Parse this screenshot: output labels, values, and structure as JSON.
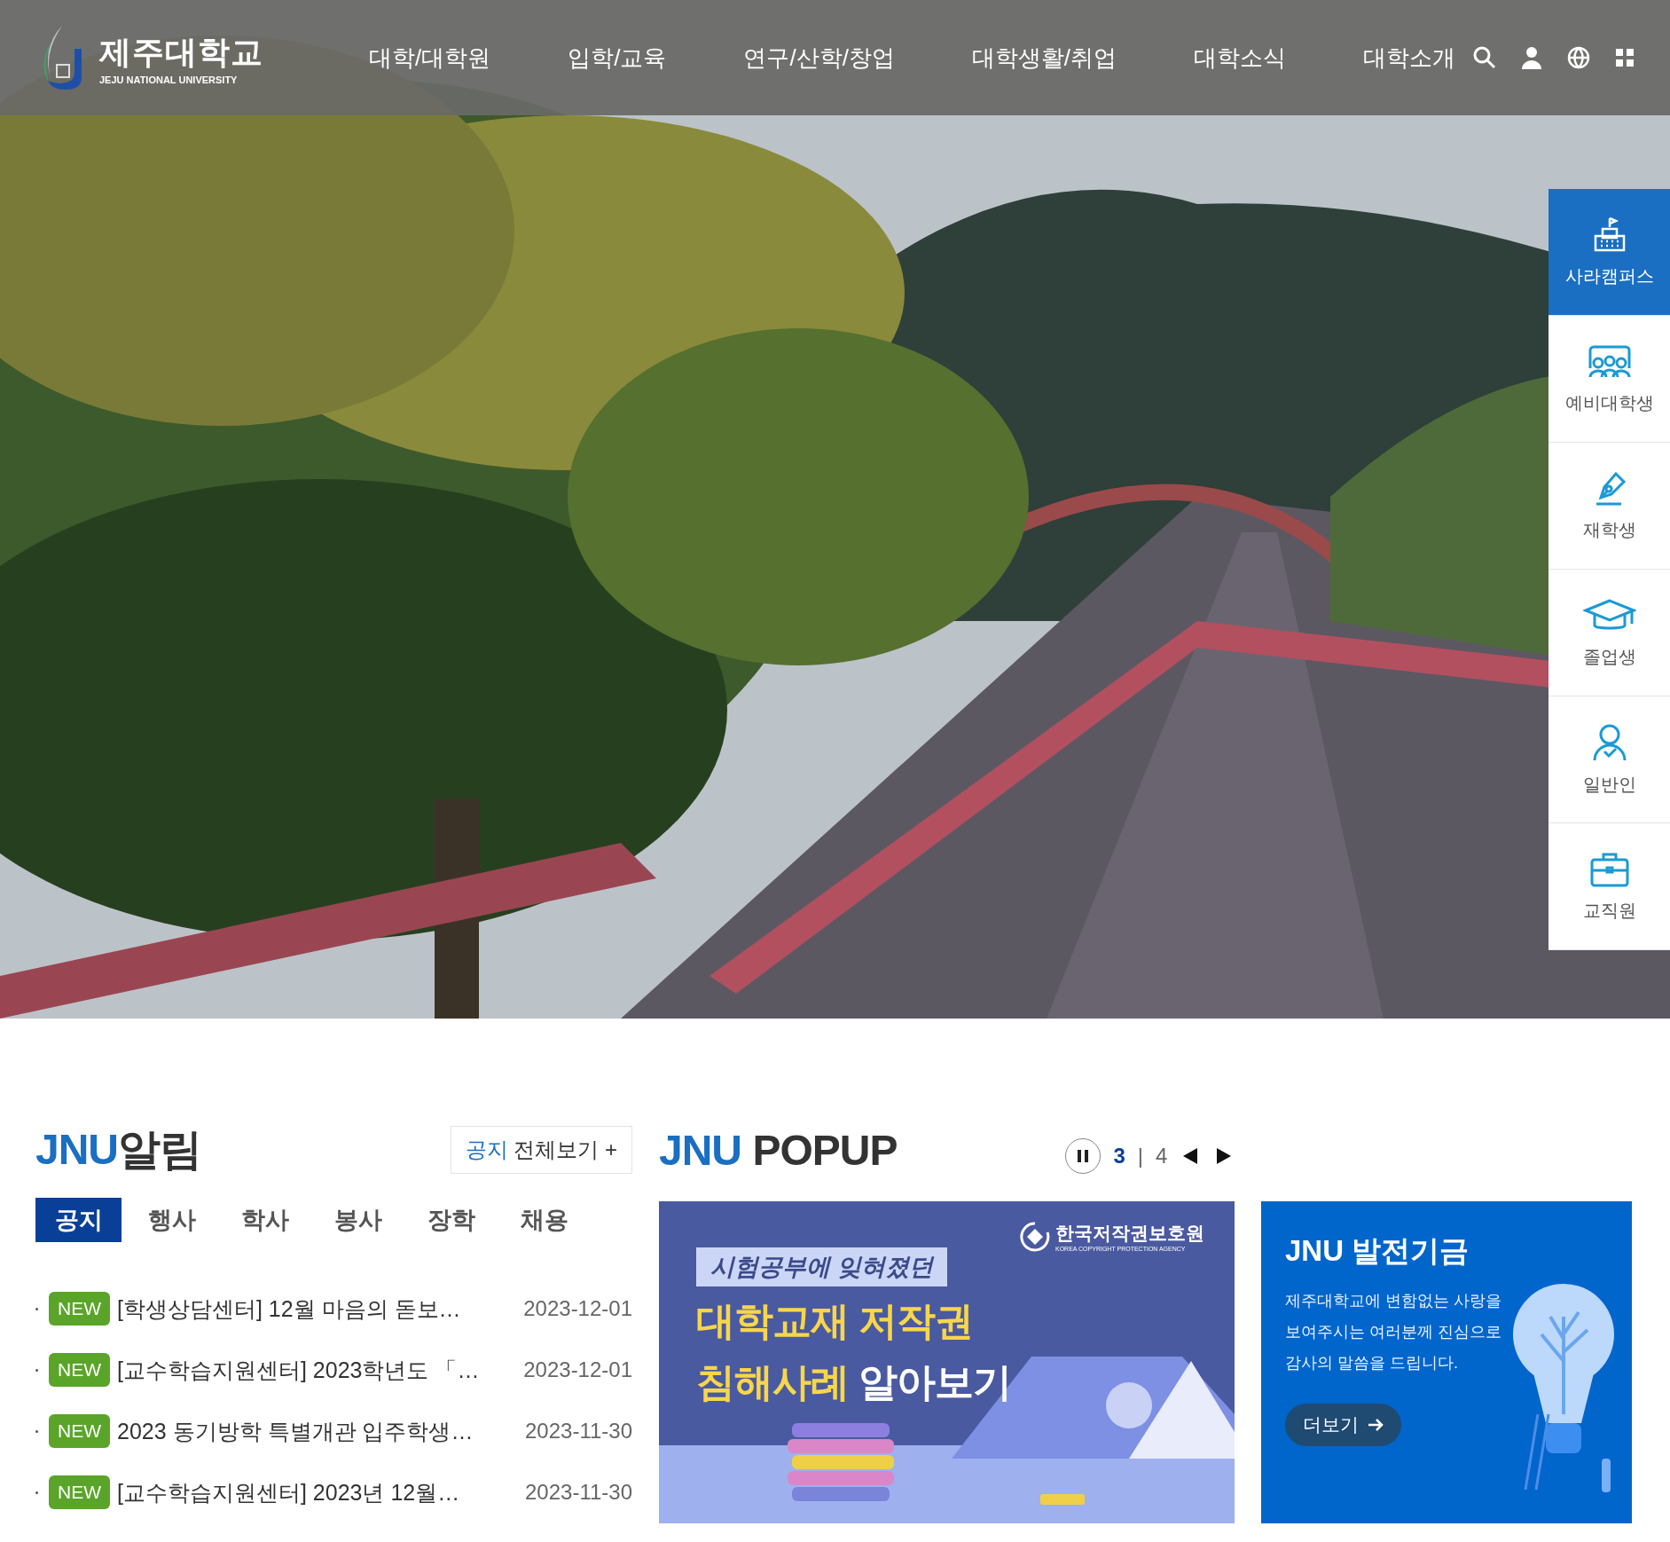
{
  "header": {
    "logo": {
      "name_ko": "제주대학교",
      "name_en": "JEJU NATIONAL UNIVERSITY"
    },
    "nav": [
      "대학/대학원",
      "입학/교육",
      "연구/산학/창업",
      "대학생활/취업",
      "대학소식",
      "대학소개"
    ]
  },
  "quick_menu": [
    {
      "label": "사라캠퍼스",
      "selected": true
    },
    {
      "label": "예비대학생",
      "selected": false
    },
    {
      "label": "재학생",
      "selected": false
    },
    {
      "label": "졸업생",
      "selected": false
    },
    {
      "label": "일반인",
      "selected": false
    },
    {
      "label": "교직원",
      "selected": false
    }
  ],
  "notices": {
    "title_prefix": "JNU",
    "title": "알림",
    "view_all_category": "공지",
    "view_all_label": "전체보기 +",
    "tabs": [
      {
        "label": "공지",
        "selected": true
      },
      {
        "label": "행사",
        "selected": false
      },
      {
        "label": "학사",
        "selected": false
      },
      {
        "label": "봉사",
        "selected": false
      },
      {
        "label": "장학",
        "selected": false
      },
      {
        "label": "채용",
        "selected": false
      }
    ],
    "items": [
      {
        "badge": "NEW",
        "title": "[학생상담센터] 12월 마음의 돋보…",
        "date": "2023-12-01"
      },
      {
        "badge": "NEW",
        "title": "[교수학습지원센터] 2023학년도 「…",
        "date": "2023-12-01"
      },
      {
        "badge": "NEW",
        "title": "2023 동기방학 특별개관 입주학생…",
        "date": "2023-11-30"
      },
      {
        "badge": "NEW",
        "title": "[교수학습지원센터] 2023년 12월…",
        "date": "2023-11-30"
      }
    ]
  },
  "popup": {
    "title_prefix": "JNU",
    "title": "POPUP",
    "current": "3",
    "separator": "|",
    "total": "4",
    "banner_1": {
      "agency_ko": "한국저작권보호원",
      "agency_en": "KOREA COPYRIGHT PROTECTION AGENCY",
      "subtitle": "시험공부에 잊혀졌던",
      "headline_1": "대학교재 저작권",
      "headline_2_highlight": "침해사례",
      "headline_2_rest": "알아보기"
    },
    "banner_2": {
      "title": "JNU 발전기금",
      "lines": [
        "제주대학교에 변함없는 사랑을",
        "보여주시는 여러분께 진심으로",
        "감사의 말씀을 드립니다."
      ],
      "button": "더보기"
    }
  }
}
